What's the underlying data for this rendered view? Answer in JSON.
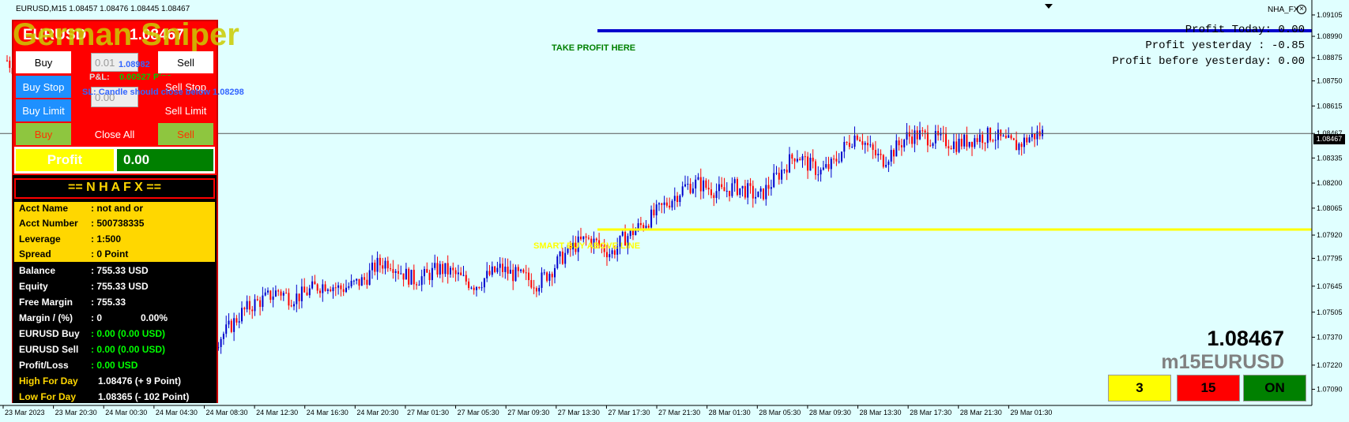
{
  "header": {
    "ohlc": "EURUSD,M15  1.08457 1.08476 1.08445 1.08467",
    "indicator_name": "NHA_FX",
    "overlay_title": "German Sniper"
  },
  "profit_info": {
    "today": "Profit Today: 0.00",
    "yesterday": "Profit yesterday : -0.85",
    "before_yesterday": "Profit before yesterday: 0.00"
  },
  "lines": {
    "take_profit": "TAKE PROFIT HERE",
    "smart_buy": "SMART BUY ABOVE LINE",
    "current_price": "1.08467"
  },
  "trade_panel": {
    "symbol": "EURUSD",
    "price": "1.08467",
    "buy": "Buy",
    "sell": "Sell",
    "lot": "0.01",
    "entry_price": "1.08982",
    "pnl_label": "P&L:",
    "pnl_value": "0.00527 Pips",
    "sl_text": "SL: Candle should close below 1.08298",
    "sl_prefix_input": "0.00",
    "buy_stop": "Buy Stop",
    "sell_stop": "Sell Stop",
    "buy_limit": "Buy Limit",
    "sell_limit": "Sell Limit",
    "buy_small": "Buy",
    "close_all": "Close All",
    "sell_small": "Sell",
    "profit_label": "Profit",
    "profit_value": "0.00"
  },
  "account": {
    "title": "== N H A F X ==",
    "rows_top": [
      {
        "label": "Acct Name",
        "value": ": not and or"
      },
      {
        "label": "Acct Number",
        "value": ": 500738335"
      },
      {
        "label": "Leverage",
        "value": ": 1:500"
      },
      {
        "label": "Spread",
        "value": ": 0 Point"
      }
    ],
    "balance_label": "Balance",
    "balance": ": 755.33 USD",
    "equity_label": "Equity",
    "equity": ": 755.33 USD",
    "free_margin_label": "Free Margin",
    "free_margin": ": 755.33",
    "margin_label": "Margin / (%)",
    "margin": ": 0",
    "margin_pct": "0.00%",
    "eurusd_buy_label": "EURUSD Buy",
    "eurusd_buy": ": 0.00 (0.00 USD)",
    "eurusd_sell_label": "EURUSD Sell",
    "eurusd_sell": ": 0.00 (0.00 USD)",
    "pl_label": "Profit/Loss",
    "pl": ": 0.00 USD",
    "high_label": "High For Day",
    "high": "1.08476 (+ 9 Point)",
    "low_label": "Low For Day",
    "low": "1.08365 (- 102 Point)"
  },
  "bottom_right": {
    "price": "1.08467",
    "symbol_tf": "m15EURUSD",
    "box1": "3",
    "box2": "15",
    "box3": "ON"
  },
  "price_axis": [
    "1.09105",
    "1.08990",
    "1.08875",
    "1.08750",
    "1.08615",
    "1.08467",
    "1.08335",
    "1.08200",
    "1.08065",
    "1.07920",
    "1.07795",
    "1.07645",
    "1.07505",
    "1.07370",
    "1.07220",
    "1.07090"
  ],
  "time_axis": [
    "23 Mar 2023",
    "23 Mar 20:30",
    "24 Mar 00:30",
    "24 Mar 04:30",
    "24 Mar 08:30",
    "24 Mar 12:30",
    "24 Mar 16:30",
    "24 Mar 20:30",
    "27 Mar 01:30",
    "27 Mar 05:30",
    "27 Mar 09:30",
    "27 Mar 13:30",
    "27 Mar 17:30",
    "27 Mar 21:30",
    "28 Mar 01:30",
    "28 Mar 05:30",
    "28 Mar 09:30",
    "28 Mar 13:30",
    "28 Mar 17:30",
    "28 Mar 21:30",
    "29 Mar 01:30"
  ],
  "colors": {
    "background": "#e0ffff",
    "bull": "#0000cc",
    "bear": "#ff0000",
    "take_profit_line": "#0000cc",
    "smart_buy_line": "#ffff00",
    "panel_border": "#ff0000"
  },
  "chart_data": {
    "type": "candlestick",
    "symbol": "EURUSD",
    "timeframe": "M15",
    "ylim": [
      1.0702,
      1.0916
    ],
    "last_price": 1.08467,
    "take_profit_level": 1.0902,
    "smart_buy_level": 1.0795,
    "path": [
      1.0886,
      1.0878,
      1.087,
      1.0862,
      1.0855,
      1.0846,
      1.0836,
      1.0826,
      1.0812,
      1.0795,
      1.0778,
      1.0762,
      1.074,
      1.0722,
      1.0712,
      1.0718,
      1.0728,
      1.0735,
      1.0742,
      1.075,
      1.0755,
      1.0758,
      1.0762,
      1.0758,
      1.076,
      1.0764,
      1.0766,
      1.0763,
      1.0765,
      1.0768,
      1.0776,
      1.0778,
      1.0772,
      1.0768,
      1.077,
      1.0774,
      1.0772,
      1.0768,
      1.0765,
      1.077,
      1.0774,
      1.0771,
      1.0769,
      1.0766,
      1.0772,
      1.078,
      1.0786,
      1.079,
      1.0787,
      1.0782,
      1.079,
      1.0795,
      1.08,
      1.0806,
      1.0812,
      1.0818,
      1.082,
      1.0817,
      1.0815,
      1.0818,
      1.0816,
      1.0812,
      1.082,
      1.0828,
      1.0836,
      1.083,
      1.0826,
      1.083,
      1.084,
      1.0847,
      1.0838,
      1.0832,
      1.0838,
      1.0845,
      1.0846,
      1.0844,
      1.0843,
      1.0841,
      1.0843,
      1.0845,
      1.0846,
      1.0842,
      1.084,
      1.0845,
      1.0847
    ]
  }
}
